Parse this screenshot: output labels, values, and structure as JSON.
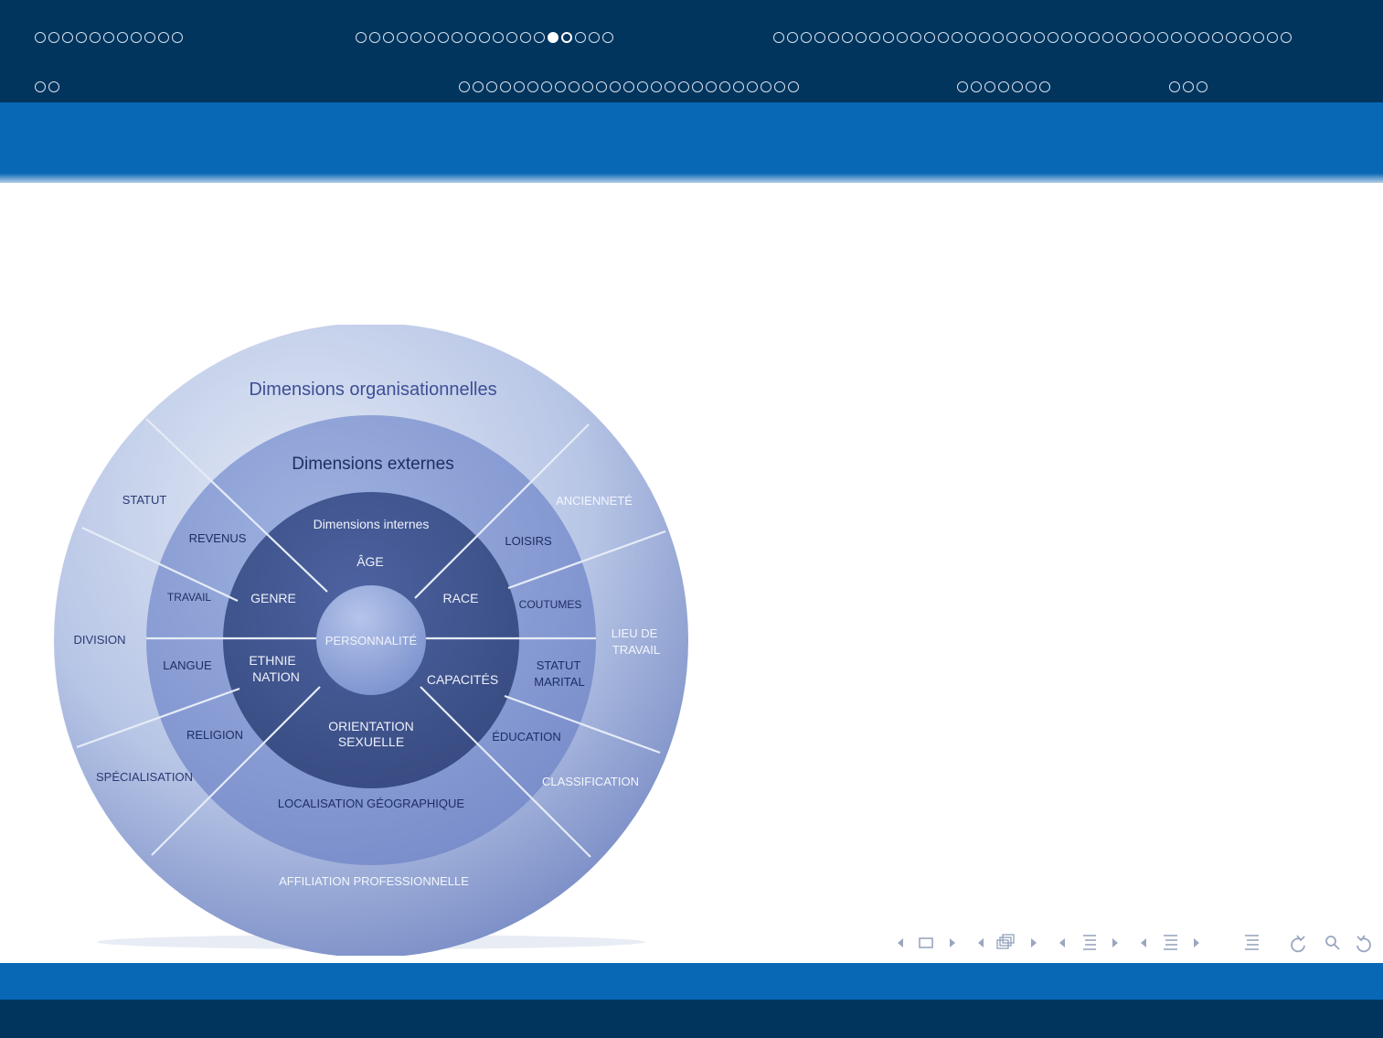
{
  "header": {
    "row1": [
      {
        "count": 11,
        "filled": null
      },
      {
        "count": 19,
        "filled": 15
      },
      {
        "count": 38,
        "filled": null
      }
    ],
    "row2": [
      {
        "count": 2,
        "filled": null
      },
      {
        "count": 25,
        "filled": null
      },
      {
        "count": 7,
        "filled": null
      },
      {
        "count": 3,
        "filled": null
      }
    ]
  },
  "diagram": {
    "ring_titles": {
      "outer": "Dimensions organisationnelles",
      "external": "Dimensions externes",
      "internal": "Dimensions internes"
    },
    "center": "PERSONNALITÉ",
    "internal": [
      "ÂGE",
      "RACE",
      "CAPACITÉS",
      "ORIENTATION",
      "SEXUELLE",
      "ETHNIE",
      "NATION",
      "GENRE"
    ],
    "external": [
      "LOISIRS",
      "COUTUMES",
      "STATUT",
      "MARITAL",
      "ÉDUCATION",
      "LOCALISATION GÉOGRAPHIQUE",
      "RELIGION",
      "LANGUE",
      "TRAVAIL",
      "REVENUS"
    ],
    "organizational": [
      "ANCIENNETÉ",
      "LIEU DE",
      "TRAVAIL",
      "CLASSIFICATION",
      "AFFILIATION PROFESSIONNELLE",
      "SPÉCIALISATION",
      "DIVISION",
      "STATUT"
    ]
  },
  "colors": {
    "header_dark": "#01355e",
    "header_blue": "#0868b6",
    "ring_outer": "#a9b8de",
    "ring_external": "#7f95cc",
    "ring_internal": "#3f5388",
    "center": "#8ea2d6"
  },
  "navigation": {
    "icons": [
      "nav-prev-frame-icon",
      "nav-frame-icon",
      "nav-next-frame-icon",
      "nav-prev-slide-icon",
      "nav-slide-icon",
      "nav-next-slide-icon",
      "nav-prev-subsection-icon",
      "nav-subsection-icon",
      "nav-next-subsection-icon",
      "nav-prev-section-icon",
      "nav-section-icon",
      "nav-next-section-icon",
      "nav-outline-icon",
      "nav-back-icon",
      "nav-search-icon",
      "nav-forward-icon"
    ]
  }
}
